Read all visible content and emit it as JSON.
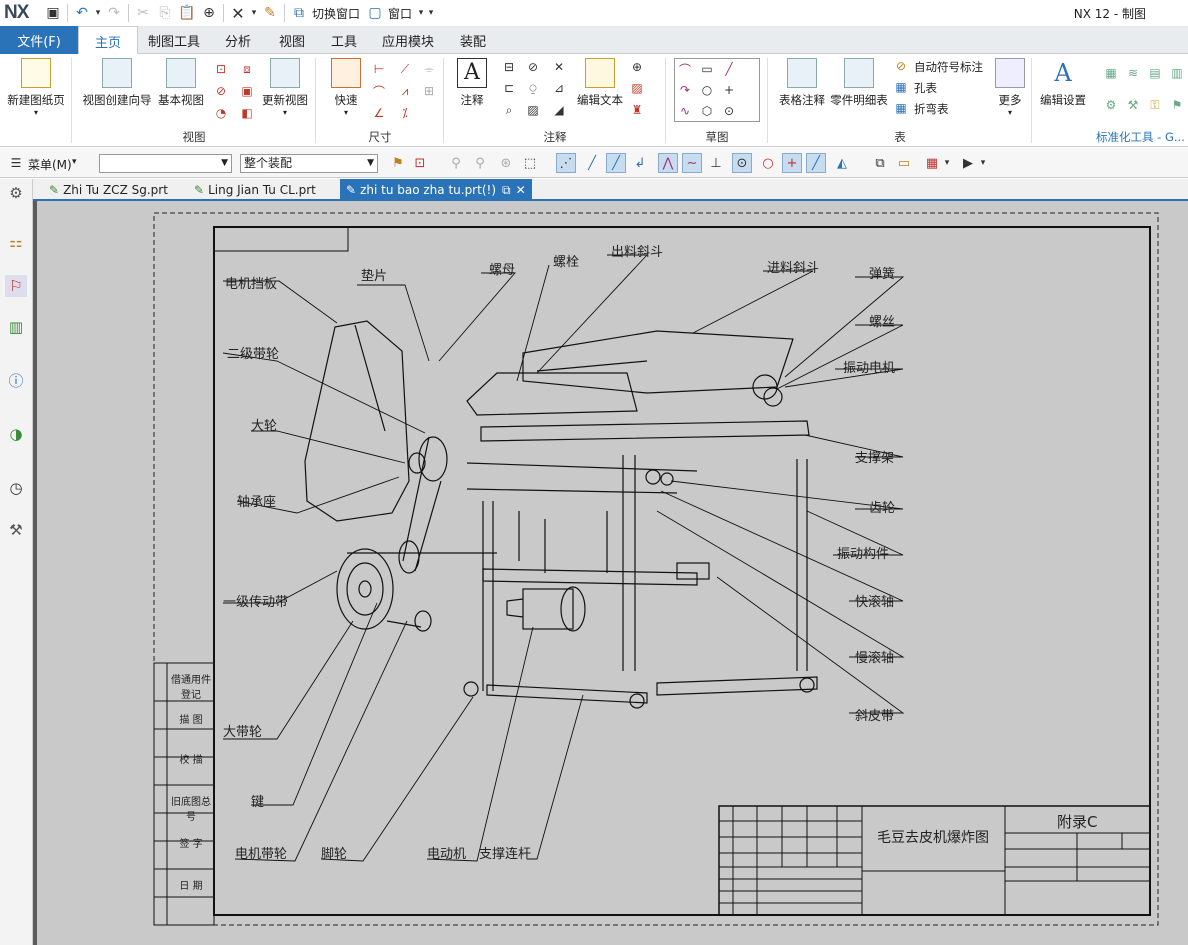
{
  "app": {
    "logo": "NX",
    "window_title": "NX 12 - 制图"
  },
  "quick_access": {
    "switch_window": "切换窗口",
    "window": "窗口"
  },
  "menu": {
    "file": "文件(F)",
    "tabs": [
      {
        "label": "主页",
        "active": true
      },
      {
        "label": "制图工具"
      },
      {
        "label": "分析"
      },
      {
        "label": "视图"
      },
      {
        "label": "工具"
      },
      {
        "label": "应用模块"
      },
      {
        "label": "装配"
      }
    ]
  },
  "ribbon": {
    "new_sheet": "新建图纸页",
    "view_wizard": "视图创建向导",
    "base_view": "基本视图",
    "update_view": "更新视图",
    "group_view": "视图",
    "rapid": "快速",
    "group_dim": "尺寸",
    "note": "注释",
    "edit_text": "编辑文本",
    "group_anno": "注释",
    "group_sketch": "草图",
    "table_note": "表格注释",
    "parts_list": "零件明细表",
    "auto_balloon": "自动符号标注",
    "hole_table": "孔表",
    "bend_table": "折弯表",
    "group_table": "表",
    "more": "更多",
    "edit_settings": "编辑设置",
    "std_tools": "标准化工具 - G..."
  },
  "toolbar": {
    "menu": "菜单(M)",
    "filter_value": "",
    "assembly_scope": "整个装配"
  },
  "file_tabs": [
    {
      "label": "Zhi Tu ZCZ Sg.prt"
    },
    {
      "label": "Ling Jian Tu CL.prt"
    },
    {
      "label": "zhi tu bao zha tu.prt(!)",
      "active": true
    }
  ],
  "drawing": {
    "labels_left": [
      "电机挡板",
      "垫片",
      "二级带轮",
      "大轮",
      "轴承座",
      "一级传动带",
      "大带轮",
      "键",
      "电机带轮",
      "脚轮",
      "电动机",
      "支撑连杆"
    ],
    "labels_top": [
      "螺母",
      "螺栓",
      "出料斜斗"
    ],
    "labels_right": [
      "进料斜斗",
      "弹簧",
      "螺丝",
      "振动电机",
      "支撑架",
      "齿轮",
      "振动构件",
      "快滚轴",
      "慢滚轴",
      "斜皮带"
    ],
    "side_block": [
      "借通用件登记",
      "描 图",
      "校 描",
      "旧底图总号",
      "签 字",
      "日 期"
    ],
    "title_block": {
      "title": "毛豆去皮机爆炸图",
      "appendix": "附录C"
    }
  }
}
